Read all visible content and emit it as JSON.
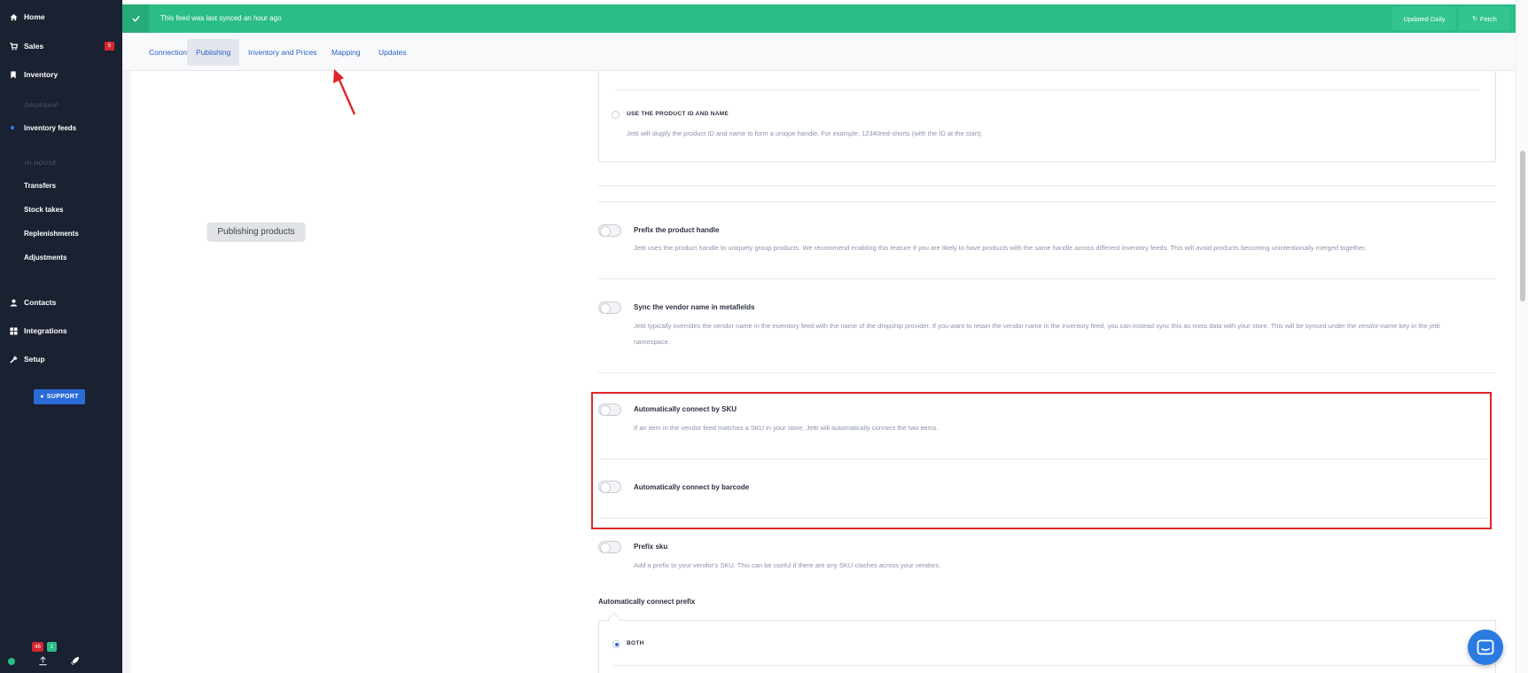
{
  "sidebar": {
    "nav": [
      {
        "label": "Home",
        "icon": "home-icon"
      },
      {
        "label": "Sales",
        "icon": "cart-icon",
        "badge": "5"
      },
      {
        "label": "Inventory",
        "icon": "bookmark-icon"
      }
    ],
    "section_dropship": "DROPSHIP",
    "inventory_feeds": "Inventory feeds",
    "section_inhouse": "IN-HOUSE",
    "inhouse_items": [
      "Transfers",
      "Stock takes",
      "Replenishments",
      "Adjustments"
    ],
    "nav_bottom": [
      {
        "label": "Contacts",
        "icon": "user-icon"
      },
      {
        "label": "Integrations",
        "icon": "grid-icon"
      },
      {
        "label": "Setup",
        "icon": "wrench-icon"
      }
    ],
    "support_label": "SUPPORT",
    "footer_badge_red": "46",
    "footer_badge_green": "1"
  },
  "sync_bar": {
    "text": "This feed was last synced an hour ago",
    "updated_label": "Updated Daily",
    "fetch_label": "Fetch"
  },
  "tabs": [
    "Connection",
    "Publishing",
    "Inventory and Prices",
    "Mapping",
    "Updates"
  ],
  "active_tab": "Publishing",
  "tooltip": "Publishing products",
  "handle_option": {
    "title": "USE THE PRODUCT ID AND NAME",
    "desc": "Jetti will slugify the product ID and name to form a unique handle. For example, 12340red-shorts (with the ID at the start)."
  },
  "settings": {
    "prefix_handle": {
      "title": "Prefix the product handle",
      "desc": "Jetti uses the product handle to uniquely group products. We recommend enabling this feature if you are likely to have products with the same handle across different inventory feeds. This will avoid products becoming unintentionally merged together."
    },
    "sync_vendor": {
      "title": "Sync the vendor name in metafields",
      "desc_1": "Jetti typically overrides the vendor name in the inventory feed with the name of the dropship provider. If you want to retain the vendor name in the inventory feed, you can instead sync this as meta data with your store. This will be synced under the ",
      "desc_em1": "vendor-name",
      "desc_2": " key in the ",
      "desc_em2": "jetti",
      "desc_3": "namespace."
    },
    "connect_sku": {
      "title": "Automatically connect by SKU",
      "desc": "If an item in the vendor feed matches a SKU in your store, Jetti will automatically connect the two items."
    },
    "connect_barcode": {
      "title": "Automatically connect by barcode"
    },
    "prefix_sku": {
      "title": "Prefix sku",
      "desc": "Add a prefix to your vendor's SKU. This can be useful if there are any SKU clashes across your vendors."
    }
  },
  "connect_prefix": {
    "label": "Automatically connect prefix",
    "option": "BOTH"
  },
  "colors": {
    "sidebar": "#1a2130",
    "sync_green": "#2bbd86",
    "link_blue": "#2a62c8",
    "highlight_red": "#e0252b"
  }
}
